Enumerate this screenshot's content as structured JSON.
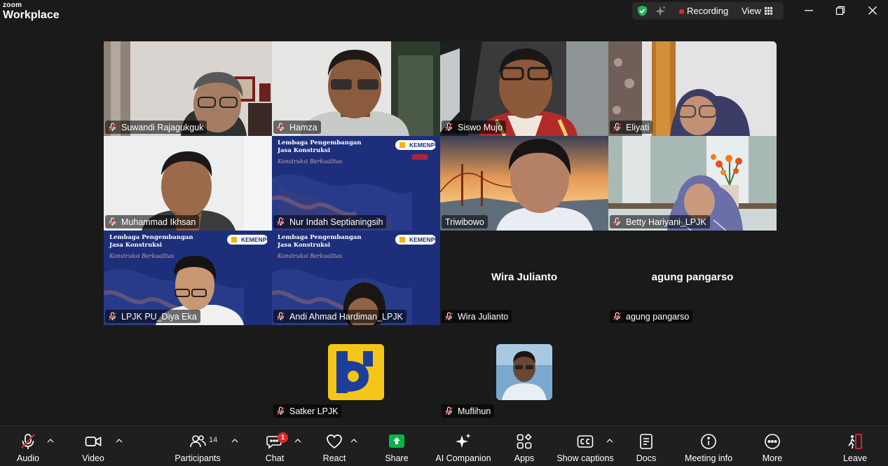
{
  "app": {
    "brand_top": "zoom",
    "brand_bottom": "Workplace"
  },
  "status": {
    "recording_label": "Recording",
    "view_label": "View"
  },
  "participants": [
    {
      "name": "Suwandi Rajagukguk",
      "muted": true
    },
    {
      "name": "Hamza",
      "muted": true
    },
    {
      "name": "Siswo Mujo",
      "muted": true
    },
    {
      "name": "Eliyati",
      "muted": true
    },
    {
      "name": "Muhammad Ikhsan",
      "muted": true
    },
    {
      "name": "Nur Indah Septianingsih",
      "muted": true
    },
    {
      "name": "Triwibowo",
      "muted": false
    },
    {
      "name": "Betty Hariyani_LPJK",
      "muted": true,
      "active_speaker": true
    },
    {
      "name": "LPJK PU_Diya Eka",
      "muted": true
    },
    {
      "name": "Andi Ahmad Hardiman_LPJK",
      "muted": true
    },
    {
      "name": "Wira Julianto",
      "muted": true,
      "video_off": true
    },
    {
      "name": "agung pangarso",
      "muted": true,
      "video_off": true
    },
    {
      "name": "Satker LPJK",
      "muted": true,
      "video_off": true
    },
    {
      "name": "Muflihun",
      "muted": true,
      "video_off": true
    }
  ],
  "slide": {
    "title_line1": "Lembaga Pengembangan",
    "title_line2": "Jasa Konstruksi",
    "tagline": "Konstruksi Berkualitas",
    "logo": "KEMENPU"
  },
  "toolbar": {
    "audio": "Audio",
    "video": "Video",
    "participants": "Participants",
    "participants_count": "14",
    "chat": "Chat",
    "chat_badge": "1",
    "react": "React",
    "share": "Share",
    "ai_companion": "AI Companion",
    "apps": "Apps",
    "show_captions": "Show captions",
    "docs": "Docs",
    "meeting_info": "Meeting info",
    "more": "More",
    "leave": "Leave"
  },
  "colors": {
    "accent_green": "#33d17a",
    "record_red": "#e02828",
    "share_green": "#0bb24a",
    "leave_red": "#e02828"
  }
}
